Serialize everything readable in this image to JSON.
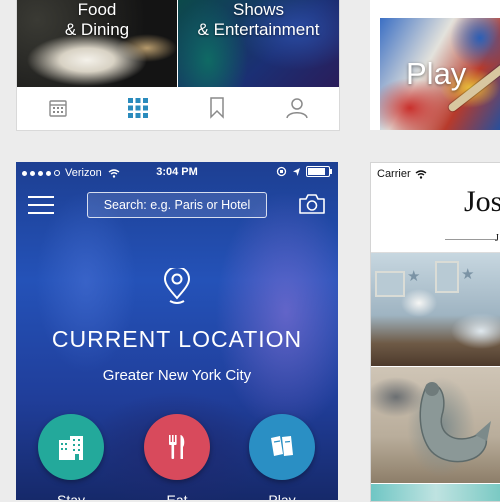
{
  "top_left": {
    "tiles": [
      {
        "line1": "Food",
        "line2": "& Dining"
      },
      {
        "line1": "Shows",
        "line2": "& Entertainment"
      }
    ],
    "tabs": [
      "calendar-icon",
      "grid-icon",
      "bookmark-icon",
      "profile-icon"
    ],
    "active_tab_color": "#2a8bbd"
  },
  "top_right": {
    "tile_label": "Play"
  },
  "phone": {
    "status": {
      "carrier": "Verizon",
      "time": "3:04 PM"
    },
    "search_placeholder": "Search: e.g. Paris or Hotel",
    "location_title": "CURRENT LOCATION",
    "location_subtitle": "Greater New York City",
    "actions": [
      {
        "label": "Stay",
        "color": "#23a99b",
        "icon": "building-icon"
      },
      {
        "label": "Eat",
        "color": "#d84a5c",
        "icon": "fork-knife-icon"
      },
      {
        "label": "Play",
        "color": "#2a8fc4",
        "icon": "tickets-icon"
      }
    ]
  },
  "right_phone": {
    "status": {
      "carrier": "Carrier"
    },
    "logo": "Jos",
    "sub_logo": "J"
  }
}
